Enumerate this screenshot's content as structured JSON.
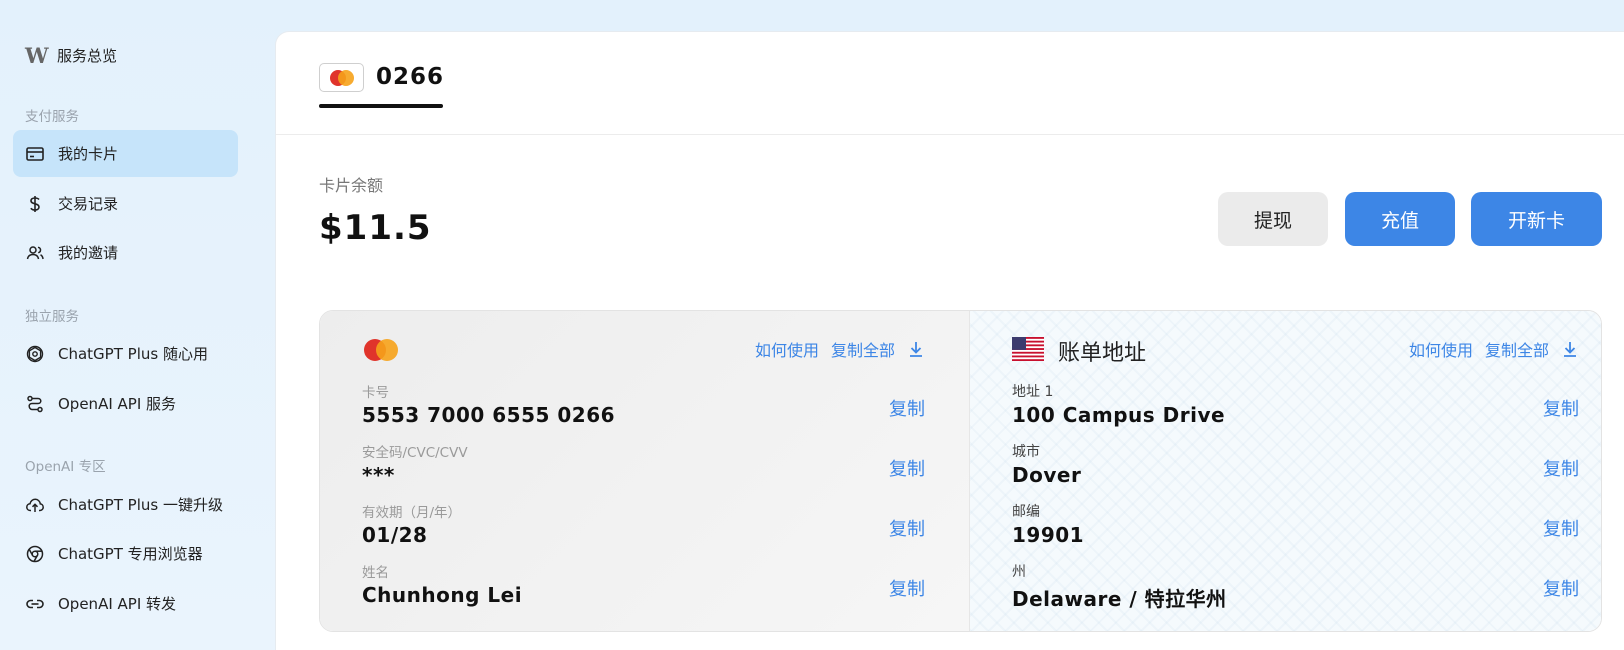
{
  "sidebar": {
    "logo_text": "服务总览",
    "sections": [
      "支付服务",
      "独立服务",
      "OpenAI 专区"
    ],
    "items": [
      {
        "label": "我的卡片",
        "icon": "card-icon"
      },
      {
        "label": "交易记录",
        "icon": "dollar-icon"
      },
      {
        "label": "我的邀请",
        "icon": "users-icon"
      },
      {
        "label": "ChatGPT Plus 随心用",
        "icon": "openai-icon"
      },
      {
        "label": "OpenAI API 服务",
        "icon": "route-icon"
      },
      {
        "label": "ChatGPT Plus 一键升级",
        "icon": "cloud-upload-icon"
      },
      {
        "label": "ChatGPT 专用浏览器",
        "icon": "browser-icon"
      },
      {
        "label": "OpenAI API 转发",
        "icon": "link-icon"
      }
    ]
  },
  "card_tab": {
    "last4": "0266"
  },
  "balance": {
    "label": "卡片余额",
    "value": "$11.5"
  },
  "buttons": {
    "withdraw": "提现",
    "recharge": "充值",
    "new_card": "开新卡"
  },
  "card_panel": {
    "how_to_use": "如何使用",
    "copy_all": "复制全部",
    "copy": "复制",
    "fields": [
      {
        "label": "卡号",
        "value": "5553 7000 6555 0266"
      },
      {
        "label": "安全码/CVC/CVV",
        "value": "***"
      },
      {
        "label": "有效期（月/年）",
        "value": "01/28"
      },
      {
        "label": "姓名",
        "value": "Chunhong Lei"
      }
    ]
  },
  "address_panel": {
    "title": "账单地址",
    "how_to_use": "如何使用",
    "copy_all": "复制全部",
    "copy": "复制",
    "fields": [
      {
        "label": "地址 1",
        "value": "100 Campus Drive"
      },
      {
        "label": "城市",
        "value": "Dover"
      },
      {
        "label": "邮编",
        "value": "19901"
      },
      {
        "label": "州",
        "value": "Delaware / 特拉华州"
      }
    ]
  },
  "colors": {
    "accent": "#3d86e6",
    "sidebar_active": "#c6e4fa",
    "mc_red": "#e0342b",
    "mc_orange": "#f6a21a"
  }
}
